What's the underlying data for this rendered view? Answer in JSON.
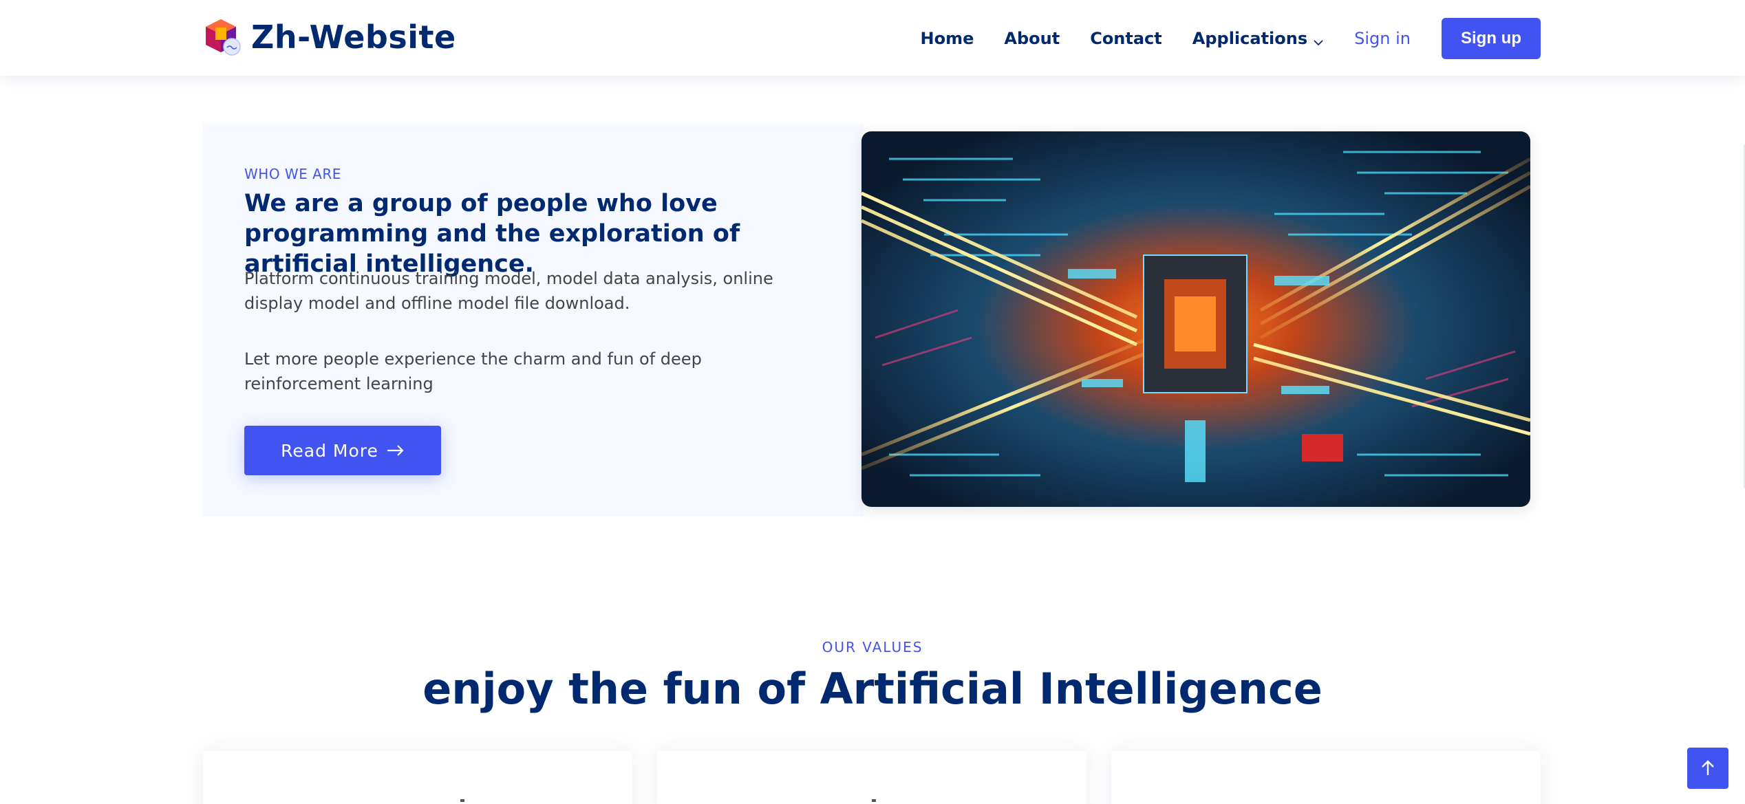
{
  "brand": {
    "name": "Zh-Website",
    "logo_icon": "cube-logo-icon"
  },
  "nav": {
    "items": [
      {
        "label": "Home"
      },
      {
        "label": "About"
      },
      {
        "label": "Contact"
      },
      {
        "label": "Applications"
      }
    ],
    "signin_label": "Sign in",
    "signup_label": "Sign up"
  },
  "about": {
    "subtitle": "WHO WE ARE",
    "title": "We are a group of people who love programming and the exploration of artificial intelligence.",
    "paragraph1": "Platform continuous training model, model data analysis, online display model and offline model file download.",
    "paragraph2": "Let more people experience the charm and fun of deep reinforcement learning",
    "button_label": "Read More",
    "button_icon": "arrow-right-icon",
    "image_desc": "glowing-circuit-board-image"
  },
  "values": {
    "subtitle": "OUR VALUES",
    "title": "enjoy the fun of Artificial Intelligence"
  },
  "back_to_top_icon": "arrow-up-icon",
  "colors": {
    "primary": "#4154f1",
    "navy": "#012970",
    "light_bg": "#f6f9ff"
  }
}
